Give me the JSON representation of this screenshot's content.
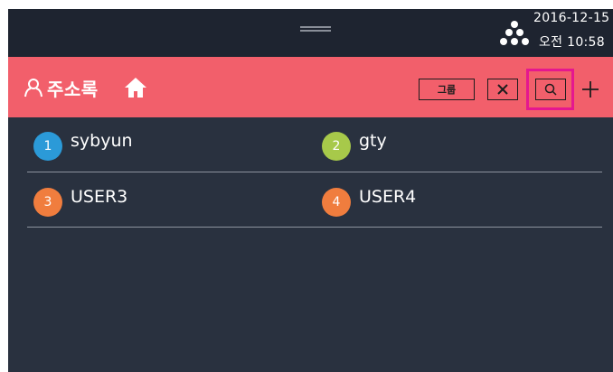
{
  "status": {
    "date": "2016-12-15",
    "time": "오전 10:58"
  },
  "header": {
    "title": "주소록",
    "group_label": "그룹",
    "icons": [
      "person-icon",
      "home-icon",
      "close-icon",
      "search-icon",
      "plus-icon"
    ]
  },
  "contacts": [
    {
      "number": "1",
      "name": "sybyun",
      "color": "#2b9ad8"
    },
    {
      "number": "2",
      "name": "gty",
      "color": "#a7c94a"
    },
    {
      "number": "3",
      "name": "USER3",
      "color": "#f07d3e"
    },
    {
      "number": "4",
      "name": "USER4",
      "color": "#f07d3e"
    }
  ],
  "colors": {
    "header": "#f25f6b",
    "background": "#29313f",
    "highlight": "#e5178f"
  }
}
